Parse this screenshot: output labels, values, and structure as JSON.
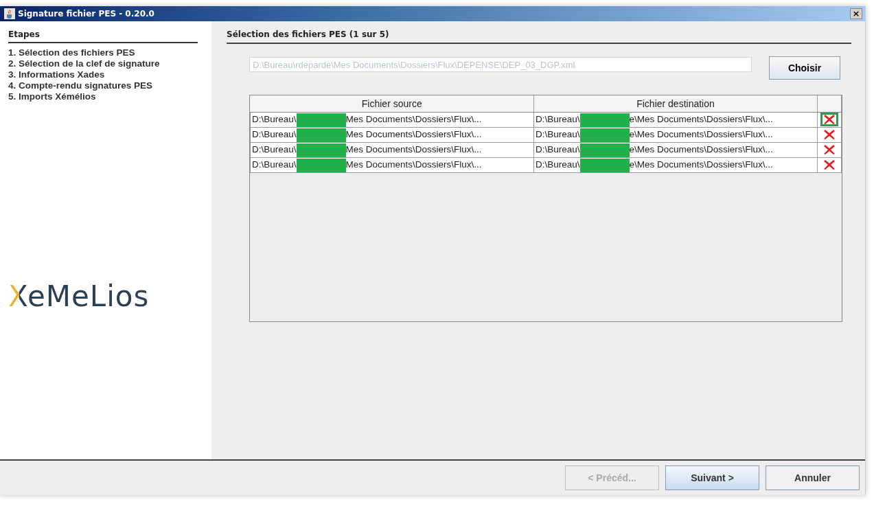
{
  "window": {
    "title": "Signature fichier PES - 0.20.0",
    "close": "×"
  },
  "sidebar": {
    "heading": "Etapes",
    "steps": [
      "1. Sélection des fichiers PES",
      "2. Sélection de la clef de signature",
      "3. Informations Xades",
      "4. Compte-rendu signatures PES",
      "5. Imports Xémélios"
    ],
    "logo": "XeMeLios"
  },
  "content": {
    "heading": "Sélection des fichiers PES (1 sur 5)",
    "file_field": {
      "value": "D:\\Bureau\\rdeparde\\Mes Documents\\Dossiers\\Flux\\DEPENSE\\DEP_03_DGP.xml",
      "disabled": true
    },
    "choose_button": "Choisir",
    "table": {
      "columns": [
        "Fichier source",
        "Fichier destination"
      ],
      "rows": [
        {
          "source": {
            "before": "D:\\Bureau\\",
            "after": "Mes Documents\\Dossiers\\Flux\\..."
          },
          "destination": {
            "before": "D:\\Bureau\\",
            "after": "e\\Mes Documents\\Dossiers\\Flux\\..."
          },
          "highlighted": true
        },
        {
          "source": {
            "before": "D:\\Bureau\\",
            "after": "Mes Documents\\Dossiers\\Flux\\..."
          },
          "destination": {
            "before": "D:\\Bureau\\",
            "after": "e\\Mes Documents\\Dossiers\\Flux\\..."
          },
          "highlighted": false
        },
        {
          "source": {
            "before": "D:\\Bureau\\",
            "after": "Mes Documents\\Dossiers\\Flux\\..."
          },
          "destination": {
            "before": "D:\\Bureau\\",
            "after": "e\\Mes Documents\\Dossiers\\Flux\\..."
          },
          "highlighted": false
        },
        {
          "source": {
            "before": "D:\\Bureau\\",
            "after": "Mes Documents\\Dossiers\\Flux\\..."
          },
          "destination": {
            "before": "D:\\Bureau\\",
            "after": "e\\Mes Documents\\Dossiers\\Flux\\..."
          },
          "highlighted": false
        }
      ]
    }
  },
  "buttons": [
    {
      "label": "< Précéd...",
      "disabled": true,
      "default": false
    },
    {
      "label": "Suivant >",
      "disabled": false,
      "default": true
    },
    {
      "label": "Annuler",
      "disabled": false,
      "default": false
    }
  ]
}
